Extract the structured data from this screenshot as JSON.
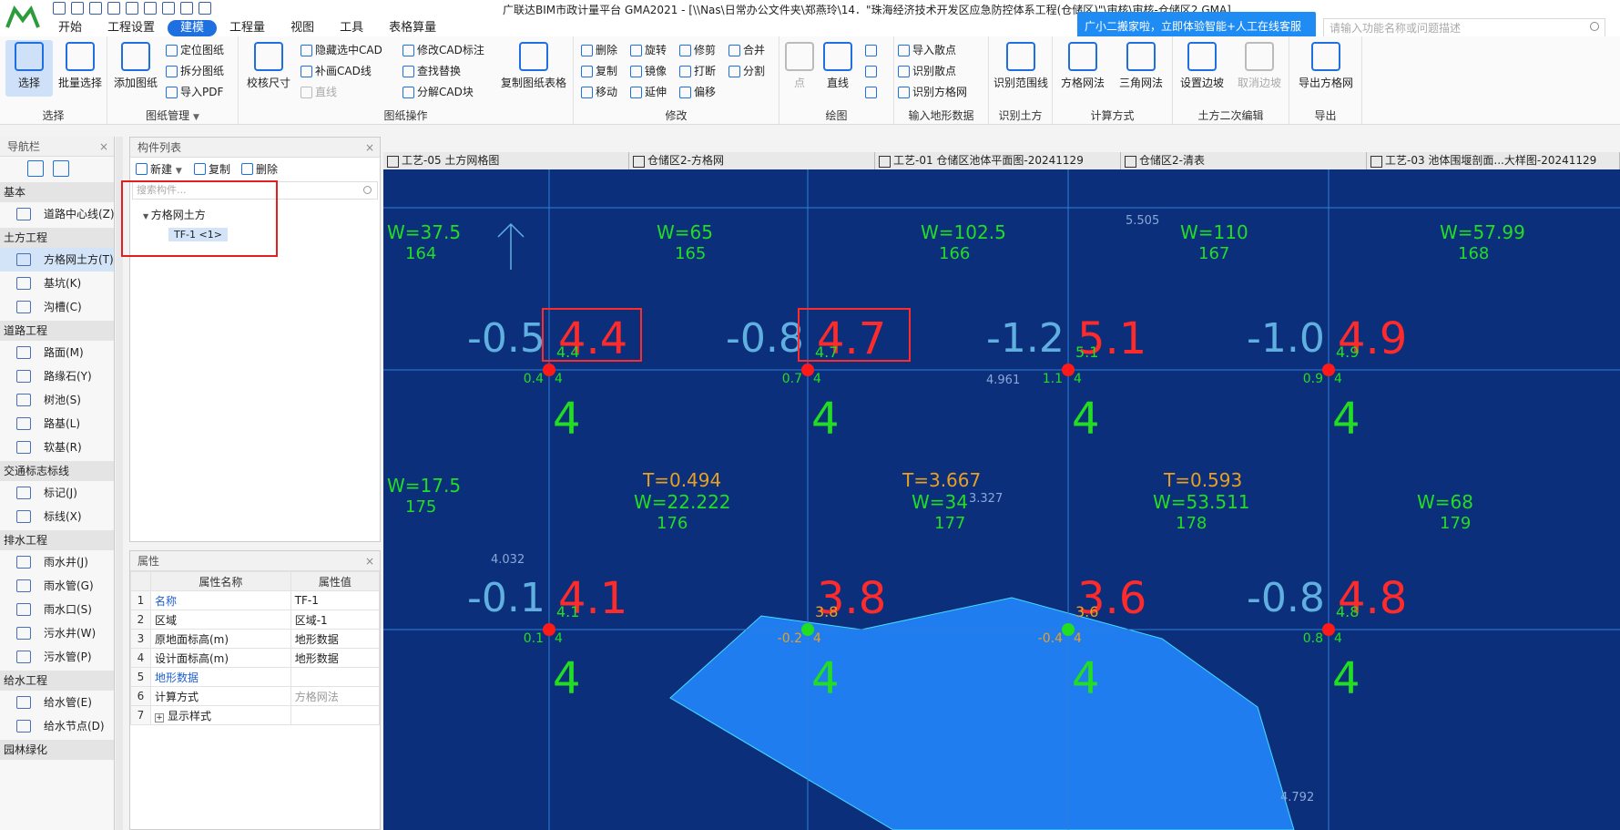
{
  "window": {
    "title": "广联达BIM市政计量平台 GMA2021 - [\\\\Nas\\日常办公文件夹\\郑燕玲\\14．\"珠海经济技术开发区应急防控体系工程(仓储区)\"\\审核\\审核-仓储区2.GMA]"
  },
  "menu": {
    "tabs": [
      "开始",
      "工程设置",
      "建模",
      "工程量",
      "视图",
      "工具",
      "表格算量"
    ],
    "active_index": 2
  },
  "promo": {
    "text": "广小二搬家啦，立即体验智能+人工在线客服"
  },
  "help_search": {
    "placeholder": "请输入功能名称或问题描述"
  },
  "ribbon": {
    "select": {
      "label": "选择",
      "buttons": [
        "选择",
        "批量选择"
      ]
    },
    "drawing_mgmt": {
      "label": "图纸管理",
      "add": "添加图纸",
      "locate": "定位图纸",
      "split": "拆分图纸",
      "import_pdf": "导入PDF"
    },
    "drawing_ops": {
      "label": "图纸操作",
      "check_size": "校核尺寸",
      "hide_cad": "隐藏选中CAD",
      "fill_cad": "补画CAD线",
      "line": "直线",
      "modify_cad": "修改CAD标注",
      "find_replace": "查找替换",
      "explode_cad": "分解CAD块",
      "copy_table": "复制图纸表格"
    },
    "modify": {
      "label": "修改",
      "items": [
        "删除",
        "旋转",
        "修剪",
        "合并",
        "复制",
        "镜像",
        "打断",
        "分割",
        "移动",
        "延伸",
        "偏移"
      ]
    },
    "draw": {
      "label": "绘图",
      "point": "点",
      "line": "直线"
    },
    "terrain": {
      "label": "输入地形数据",
      "import_points": "导入散点",
      "identify_points": "识别散点",
      "identify_grid": "识别方格网"
    },
    "identify_earth": {
      "label": "识别土方",
      "range": "识别范围线"
    },
    "calc": {
      "label": "计算方式",
      "grid": "方格网法",
      "triangle": "三角网法"
    },
    "secondary": {
      "label": "土方二次编辑",
      "set_slope": "设置边坡",
      "cancel_slope": "取消边坡"
    },
    "export": {
      "label": "导出",
      "export_grid": "导出方格网"
    }
  },
  "nav": {
    "title": "导航栏",
    "groups": [
      {
        "category": "基本",
        "items": [
          "道路中心线(Z)"
        ]
      },
      {
        "category": "土方工程",
        "items": [
          "方格网土方(T)",
          "基坑(K)",
          "沟槽(C)"
        ]
      },
      {
        "category": "道路工程",
        "items": [
          "路面(M)",
          "路缘石(Y)",
          "树池(S)",
          "路基(L)",
          "软基(R)"
        ]
      },
      {
        "category": "交通标志标线",
        "items": [
          "标记(J)",
          "标线(X)"
        ]
      },
      {
        "category": "排水工程",
        "items": [
          "雨水井(J)",
          "雨水管(G)",
          "雨水口(S)",
          "污水井(W)",
          "污水管(P)"
        ]
      },
      {
        "category": "给水工程",
        "items": [
          "给水管(E)",
          "给水节点(D)"
        ]
      },
      {
        "category": "园林绿化",
        "items": []
      }
    ],
    "selected": "方格网土方(T)"
  },
  "components": {
    "title": "构件列表",
    "new": "新建",
    "copy": "复制",
    "delete": "删除",
    "search_placeholder": "搜索构件...",
    "tree_root": "方格网土方",
    "tree_child": "TF-1 <1>"
  },
  "properties": {
    "title": "属性",
    "headers": [
      "属性名称",
      "属性值"
    ],
    "rows": [
      {
        "i": "1",
        "name": "名称",
        "value": "TF-1"
      },
      {
        "i": "2",
        "name": "区域",
        "value": "区域-1"
      },
      {
        "i": "3",
        "name": "原地面标高(m)",
        "value": "地形数据"
      },
      {
        "i": "4",
        "name": "设计面标高(m)",
        "value": "地形数据"
      },
      {
        "i": "5",
        "name": "地形数据",
        "value": ""
      },
      {
        "i": "6",
        "name": "计算方式",
        "value": "方格网法"
      },
      {
        "i": "7",
        "name": "显示样式",
        "value": ""
      }
    ]
  },
  "doc_tabs": [
    "工艺-05 土方网格图",
    "仓储区2-方格网",
    "工艺-01 仓储区池体平面图-20241129",
    "仓储区2-清表",
    "工艺-03 池体围堰剖面...大样图-20241129"
  ],
  "canvas": {
    "colors": {
      "bg": "#0c2f7b",
      "grid": "#2c7fd8",
      "fill": "#1f7df0",
      "red": "#ff2a2a",
      "green": "#22dd22",
      "orange": "#e8a020",
      "cyan": "#5fb0e0"
    },
    "red_values": [
      "4.4",
      "4.7",
      "5.1",
      "4.9",
      "4.1",
      "3.8",
      "3.6",
      "4.8"
    ],
    "cut_labels": [
      "-0.5",
      "-0.8",
      "-1.2",
      "-1.0",
      "-0.1",
      "-0.8"
    ],
    "fill_labels": [
      "0.4",
      "0.7",
      "1.1",
      "0.9",
      "0.1",
      "-0.2",
      "-0.4",
      "0.8"
    ],
    "small_vals": [
      "4.4",
      "4.7",
      "5.1",
      "4.9",
      "4.1",
      "3.8",
      "3.6",
      "4.8"
    ],
    "design_val": "4",
    "big_orig": [
      "4.4",
      "4.7",
      "5.1",
      "4.9",
      "4.1",
      "4.8",
      "4.0"
    ],
    "top_w": [
      "W=37.5",
      "W=65",
      "W=102.5",
      "W=110",
      "W=57.99"
    ],
    "top_w2": [
      "164",
      "165",
      "166",
      "167",
      "168"
    ],
    "mid_t": [
      "T=0.494",
      "T=3.667",
      "T=0.593"
    ],
    "mid_w": [
      "W=22.222",
      "W=34",
      "W=53.511",
      "W=68"
    ],
    "left_w": "W=17.5",
    "left_w2": "175",
    "mid_w2": [
      "176",
      "177",
      "178",
      "179"
    ],
    "spot": [
      "5.505",
      "4.961",
      "3.327",
      "4.032",
      "4.792"
    ]
  }
}
